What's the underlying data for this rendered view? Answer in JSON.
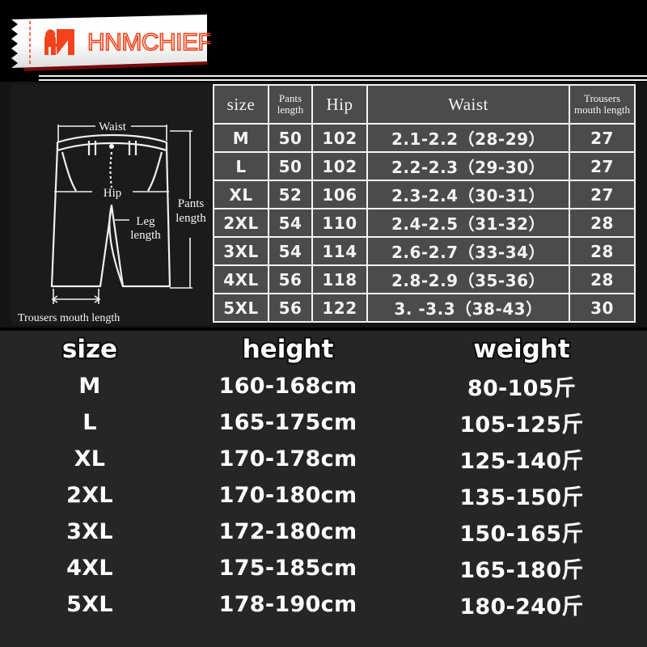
{
  "brand": {
    "name": "HNMCHIEF",
    "logo_icon": "elephant-logo-icon",
    "accent_color": "#f4431c",
    "ribbon_color": "#ffffff"
  },
  "diagram": {
    "title": "pants-measurement-diagram",
    "labels": {
      "waist": "Waist",
      "hip": "Hip",
      "leg_length": "Leg length",
      "pants_length": "Pants length",
      "trousers_mouth_length": "Trousers mouth length"
    }
  },
  "spec_table": {
    "headers": {
      "size": "size",
      "pants_length_line1": "Pants",
      "pants_length_line2": "length",
      "hip": "Hip",
      "waist": "Waist",
      "mouth_line1": "Trousers",
      "mouth_line2": "mouth length"
    },
    "rows": [
      {
        "size": "M",
        "pants_length": "50",
        "hip": "102",
        "waist": "2.1-2.2（28-29）",
        "mouth": "27"
      },
      {
        "size": "L",
        "pants_length": "50",
        "hip": "102",
        "waist": "2.2-2.3（29-30）",
        "mouth": "27"
      },
      {
        "size": "XL",
        "pants_length": "52",
        "hip": "106",
        "waist": "2.3-2.4（30-31）",
        "mouth": "27"
      },
      {
        "size": "2XL",
        "pants_length": "54",
        "hip": "110",
        "waist": "2.4-2.5（31-32）",
        "mouth": "28"
      },
      {
        "size": "3XL",
        "pants_length": "54",
        "hip": "114",
        "waist": "2.6-2.7（33-34）",
        "mouth": "28"
      },
      {
        "size": "4XL",
        "pants_length": "56",
        "hip": "118",
        "waist": "2.8-2.9（35-36）",
        "mouth": "28"
      },
      {
        "size": "5XL",
        "pants_length": "56",
        "hip": "122",
        "waist": "3. -3.3（38-43）",
        "mouth": "30"
      }
    ]
  },
  "size_guide": {
    "headers": {
      "size": "size",
      "height": "height",
      "weight": "weight"
    },
    "rows": [
      {
        "size": "M",
        "height": "160-168cm",
        "weight": "80-105斤"
      },
      {
        "size": "L",
        "height": "165-175cm",
        "weight": "105-125斤"
      },
      {
        "size": "XL",
        "height": "170-178cm",
        "weight": "125-140斤"
      },
      {
        "size": "2XL",
        "height": "170-180cm",
        "weight": "135-150斤"
      },
      {
        "size": "3XL",
        "height": "172-180cm",
        "weight": "150-165斤"
      },
      {
        "size": "4XL",
        "height": "175-185cm",
        "weight": "165-180斤"
      },
      {
        "size": "5XL",
        "height": "178-190cm",
        "weight": "180-240斤"
      }
    ]
  }
}
